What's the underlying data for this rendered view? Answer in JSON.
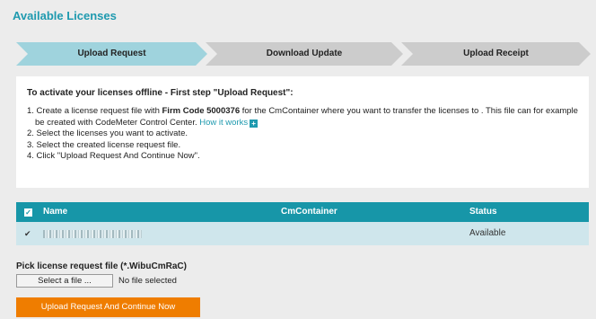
{
  "page": {
    "title": "Available Licenses"
  },
  "steps": [
    {
      "label": "Upload Request",
      "active": true
    },
    {
      "label": "Download Update",
      "active": false
    },
    {
      "label": "Upload Receipt",
      "active": false
    }
  ],
  "colors": {
    "accent": "#1f9aaf",
    "table_header": "#1796a8",
    "active_step": "#9fd3dd",
    "inactive_step": "#cccccc",
    "button": "#ef7d00"
  },
  "instructions": {
    "heading": "To activate your licenses offline - First step \"Upload Request\":",
    "item1_prefix": "1. Create a license request file with ",
    "item1_bold": "Firm Code 5000376",
    "item1_suffix": " for the CmContainer where you want to transfer the licenses to . This file can for example be created with CodeMeter Control Center. ",
    "item1_link": "How it works",
    "item1_icon": "plus-icon",
    "item2": "2. Select the licenses you want to activate.",
    "item3": "3. Select the created license request file.",
    "item4": "4. Click \"Upload Request And Continue Now\"."
  },
  "table": {
    "headers": {
      "name": "Name",
      "container": "CmContainer",
      "status": "Status"
    },
    "rows": [
      {
        "checked": true,
        "name_redacted": true,
        "container": "",
        "status": "Available"
      }
    ]
  },
  "file_pick": {
    "label": "Pick license request file (*.WibuCmRaC)",
    "button_label": "Select a file ...",
    "status": "No file selected"
  },
  "submit": {
    "label": "Upload Request And Continue Now"
  }
}
